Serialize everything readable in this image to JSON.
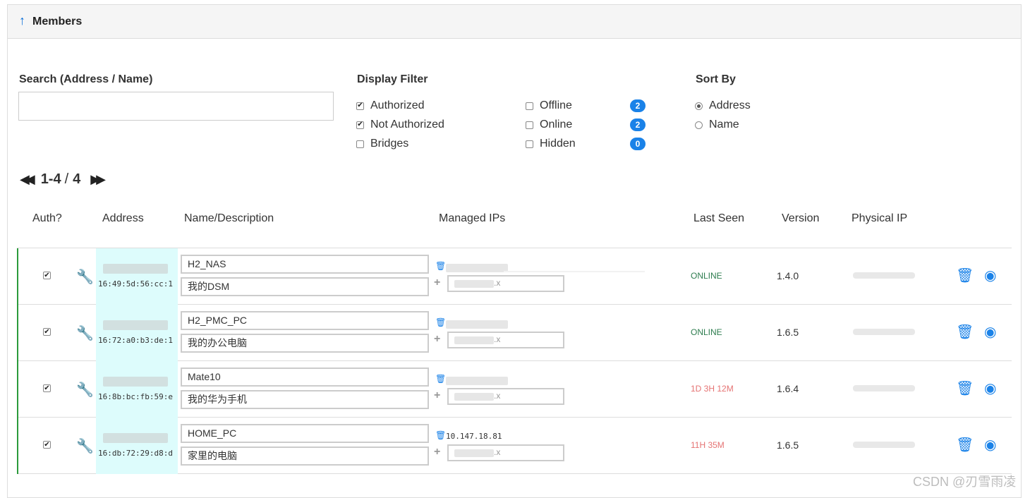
{
  "panel": {
    "title": "Members",
    "arrow_icon": "↑"
  },
  "search": {
    "label": "Search (Address / Name)",
    "value": "",
    "placeholder": ""
  },
  "filter": {
    "label": "Display Filter",
    "options": [
      {
        "label": "Authorized",
        "checked": true
      },
      {
        "label": "Not Authorized",
        "checked": true
      },
      {
        "label": "Bridges",
        "checked": false
      }
    ],
    "status": [
      {
        "label": "Offline",
        "checked": false,
        "count": "2"
      },
      {
        "label": "Online",
        "checked": false,
        "count": "2"
      },
      {
        "label": "Hidden",
        "checked": false,
        "count": "0"
      }
    ]
  },
  "sort": {
    "label": "Sort By",
    "options": [
      {
        "label": "Address",
        "selected": true
      },
      {
        "label": "Name",
        "selected": false
      }
    ]
  },
  "pagination": {
    "range": "1-4",
    "separator": "/",
    "total": "4"
  },
  "table": {
    "headers": {
      "auth": "Auth?",
      "address": "Address",
      "name": "Name/Description",
      "ips": "Managed IPs",
      "seen": "Last Seen",
      "version": "Version",
      "physical": "Physical IP"
    },
    "rows": [
      {
        "auth": true,
        "address": "16:49:5d:56:cc:1",
        "name": "H2_NAS",
        "description": "我的DSM",
        "managed_ip": "",
        "ip_suffix": ".x",
        "last_seen": "ONLINE",
        "last_seen_color": "#2e7d4f",
        "version": "1.4.0"
      },
      {
        "auth": true,
        "address": "16:72:a0:b3:de:1",
        "name": "H2_PMC_PC",
        "description": "我的办公电脑",
        "managed_ip": "",
        "ip_suffix": ".x",
        "last_seen": "ONLINE",
        "last_seen_color": "#2e7d4f",
        "version": "1.6.5"
      },
      {
        "auth": true,
        "address": "16:8b:bc:fb:59:e",
        "name": "Mate10",
        "description": "我的华为手机",
        "managed_ip": "",
        "ip_suffix": ".x",
        "last_seen": "1D 3H 12M",
        "last_seen_color": "#e57373",
        "version": "1.6.4"
      },
      {
        "auth": true,
        "address": "16:db:72:29:d8:d",
        "name": "HOME_PC",
        "description": "家里的电脑",
        "managed_ip": "10.147.18.81",
        "ip_suffix": ".x",
        "last_seen": "11H 35M",
        "last_seen_color": "#e57373",
        "version": "1.6.5"
      }
    ]
  },
  "icons": {
    "wrench": "wrench-icon",
    "trash": "trash-icon",
    "hide": "eye-slash-icon",
    "plus": "plus-icon"
  },
  "watermark": "CSDN @刃雪雨凌"
}
